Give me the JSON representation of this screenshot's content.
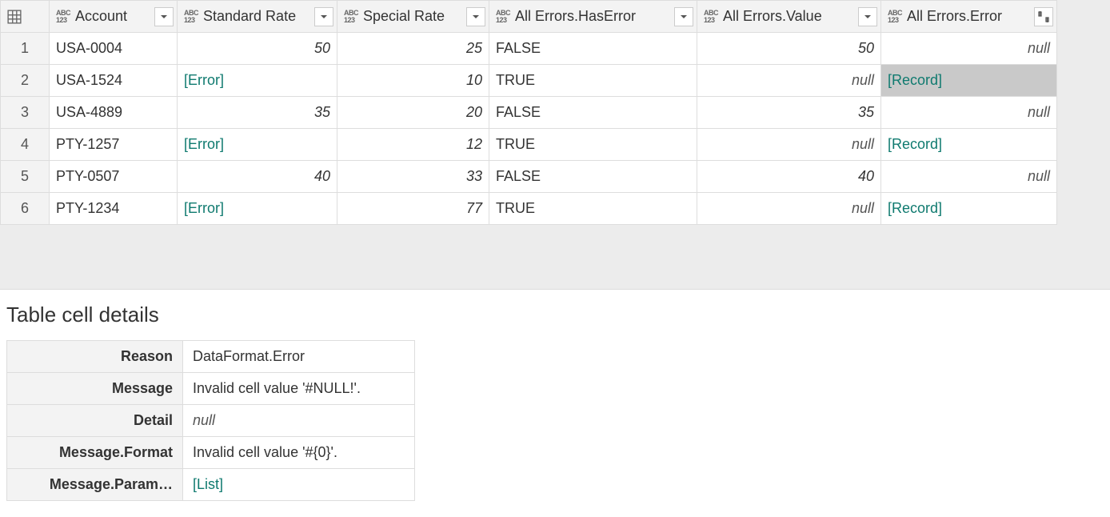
{
  "grid": {
    "columns": [
      {
        "name": "Account"
      },
      {
        "name": "Standard Rate"
      },
      {
        "name": "Special Rate"
      },
      {
        "name": "All Errors.HasError"
      },
      {
        "name": "All Errors.Value"
      },
      {
        "name": "All Errors.Error"
      }
    ],
    "rows": [
      {
        "n": "1",
        "account": "USA-0004",
        "std": {
          "text": "50",
          "kind": "num"
        },
        "spec": {
          "text": "25",
          "kind": "num"
        },
        "has": {
          "text": "FALSE",
          "kind": "text"
        },
        "val": {
          "text": "50",
          "kind": "num"
        },
        "err": {
          "text": "null",
          "kind": "null"
        }
      },
      {
        "n": "2",
        "account": "USA-1524",
        "std": {
          "text": "[Error]",
          "kind": "link"
        },
        "spec": {
          "text": "10",
          "kind": "num"
        },
        "has": {
          "text": "TRUE",
          "kind": "text"
        },
        "val": {
          "text": "null",
          "kind": "null"
        },
        "err": {
          "text": "[Record]",
          "kind": "link",
          "selected": true
        }
      },
      {
        "n": "3",
        "account": "USA-4889",
        "std": {
          "text": "35",
          "kind": "num"
        },
        "spec": {
          "text": "20",
          "kind": "num"
        },
        "has": {
          "text": "FALSE",
          "kind": "text"
        },
        "val": {
          "text": "35",
          "kind": "num"
        },
        "err": {
          "text": "null",
          "kind": "null"
        }
      },
      {
        "n": "4",
        "account": "PTY-1257",
        "std": {
          "text": "[Error]",
          "kind": "link"
        },
        "spec": {
          "text": "12",
          "kind": "num"
        },
        "has": {
          "text": "TRUE",
          "kind": "text"
        },
        "val": {
          "text": "null",
          "kind": "null"
        },
        "err": {
          "text": "[Record]",
          "kind": "link"
        }
      },
      {
        "n": "5",
        "account": "PTY-0507",
        "std": {
          "text": "40",
          "kind": "num"
        },
        "spec": {
          "text": "33",
          "kind": "num"
        },
        "has": {
          "text": "FALSE",
          "kind": "text"
        },
        "val": {
          "text": "40",
          "kind": "num"
        },
        "err": {
          "text": "null",
          "kind": "null"
        }
      },
      {
        "n": "6",
        "account": "PTY-1234",
        "std": {
          "text": "[Error]",
          "kind": "link"
        },
        "spec": {
          "text": "77",
          "kind": "num"
        },
        "has": {
          "text": "TRUE",
          "kind": "text"
        },
        "val": {
          "text": "null",
          "kind": "null"
        },
        "err": {
          "text": "[Record]",
          "kind": "link"
        }
      }
    ]
  },
  "details": {
    "title": "Table cell details",
    "rows": [
      {
        "k": "Reason",
        "v": "DataFormat.Error",
        "kind": "text"
      },
      {
        "k": "Message",
        "v": "Invalid cell value '#NULL!'.",
        "kind": "text"
      },
      {
        "k": "Detail",
        "v": "null",
        "kind": "italic"
      },
      {
        "k": "Message.Format",
        "v": "Invalid cell value '#{0}'.",
        "kind": "text"
      },
      {
        "k": "Message.Param…",
        "v": "[List]",
        "kind": "link"
      }
    ]
  },
  "type_label": {
    "top": "ABC",
    "bot": "123"
  }
}
